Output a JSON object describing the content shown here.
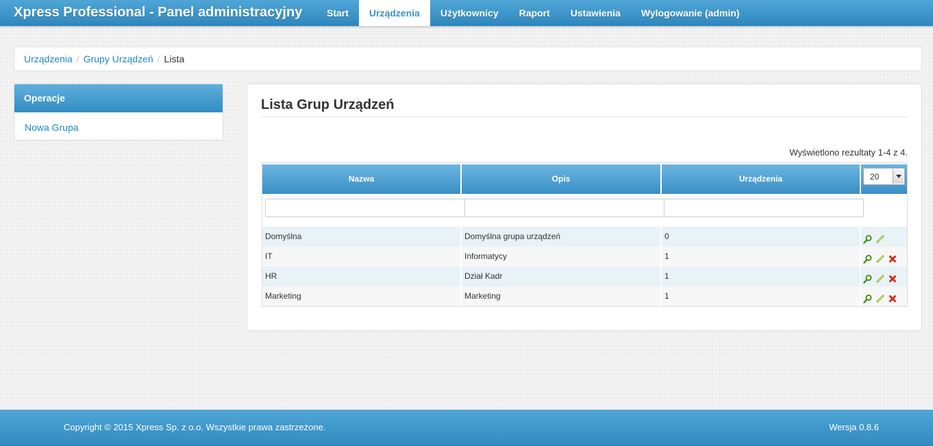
{
  "brand": "Xpress Professional - Panel administracyjny",
  "nav": [
    {
      "label": "Start",
      "active": false
    },
    {
      "label": "Urządzenia",
      "active": true
    },
    {
      "label": "Użytkownicy",
      "active": false
    },
    {
      "label": "Raport",
      "active": false
    },
    {
      "label": "Ustawienia",
      "active": false
    },
    {
      "label": "Wylogowanie (admin)",
      "active": false
    }
  ],
  "breadcrumb": {
    "items": [
      "Urządzenia",
      "Grupy Urządzeń"
    ],
    "separator": "/",
    "current": "Lista"
  },
  "sidebar": {
    "title": "Operacje",
    "items": [
      {
        "label": "Nowa Grupa"
      }
    ]
  },
  "main": {
    "title": "Lista Grup Urządzeń",
    "summary": "Wyświetlono rezultaty 1-4 z 4.",
    "page_size": "20",
    "columns": [
      "Nazwa",
      "Opis",
      "Urządzenia"
    ],
    "filters": {
      "nazwa": "",
      "opis": "",
      "urzadzenia": ""
    },
    "rows": [
      {
        "nazwa": "Domyślna",
        "opis": "Domyślna grupa urządzeń",
        "urzadzenia": "0",
        "actions": [
          "view-icon",
          "edit-icon"
        ]
      },
      {
        "nazwa": "IT",
        "opis": "Informatycy",
        "urzadzenia": "1",
        "actions": [
          "view-icon",
          "edit-icon",
          "delete-icon"
        ]
      },
      {
        "nazwa": "HR",
        "opis": "Dział Kadr",
        "urzadzenia": "1",
        "actions": [
          "view-icon",
          "edit-icon",
          "delete-icon"
        ]
      },
      {
        "nazwa": "Marketing",
        "opis": "Marketing",
        "urzadzenia": "1",
        "actions": [
          "view-icon",
          "edit-icon",
          "delete-icon"
        ]
      }
    ]
  },
  "footer": {
    "copyright": "Copyright © 2015 Xpress Sp. z o.o. Wszystkie prawa zastrzeżone.",
    "version": "Wersja 0.8.6"
  },
  "colors": {
    "accent": "#3b93c9",
    "link": "#1e8ac4",
    "row_alt": "#e8f2f7",
    "delete": "#d62b1a"
  }
}
